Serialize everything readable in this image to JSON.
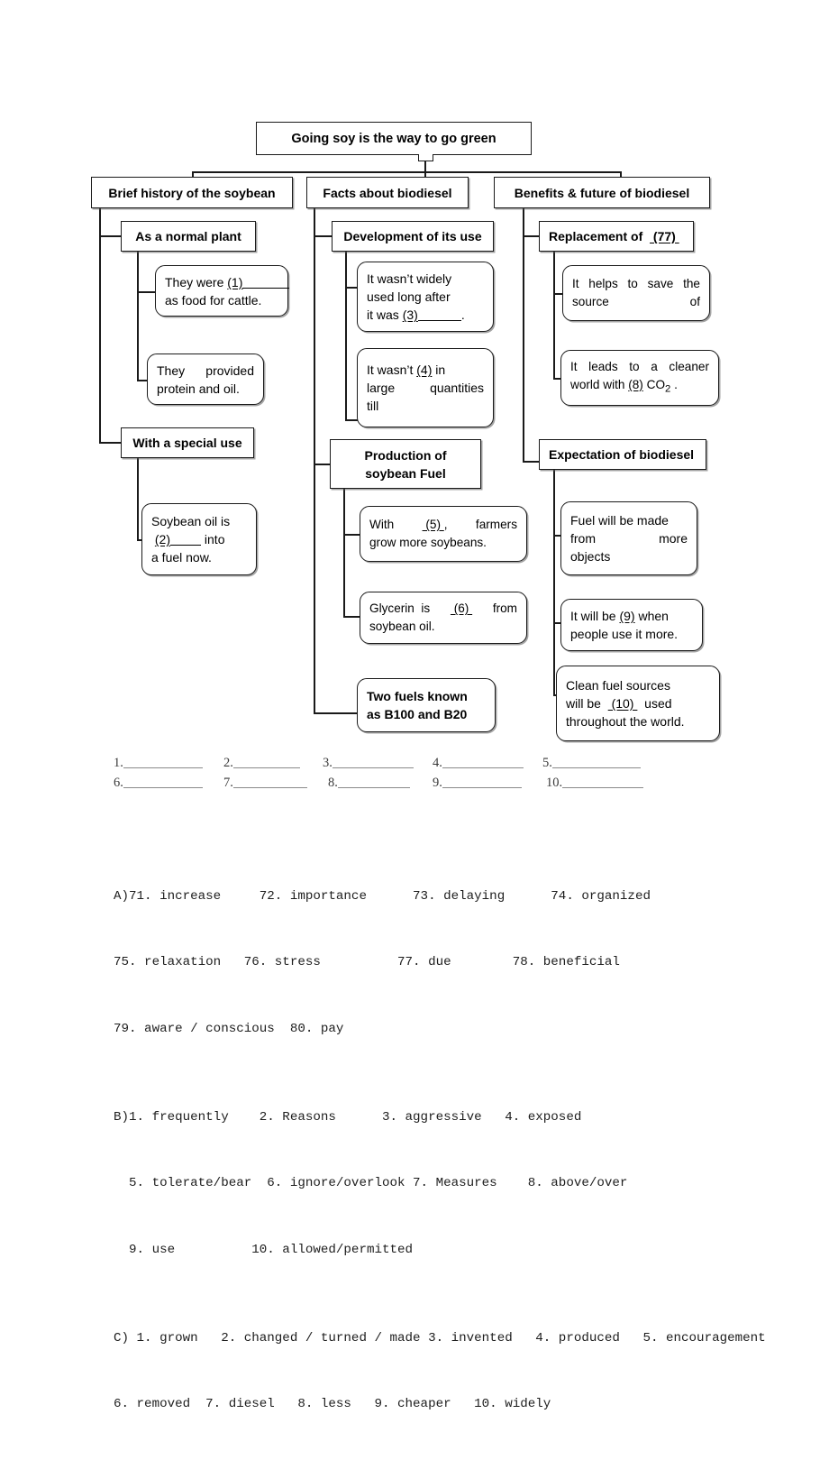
{
  "diagram": {
    "title": "Going soy is the way to go green",
    "branches": [
      {
        "heading": "Brief history of the soybean",
        "sub": [
          {
            "heading": "As a normal plant",
            "leaves": [
              {
                "lines": [
                  "They were (1)",
                  "as food for cattle."
                ],
                "blank": "(1)"
              },
              {
                "lines": [
                  "They      provided",
                  "protein and oil."
                ]
              }
            ]
          },
          {
            "heading": "With a special use",
            "leaves": [
              {
                "lines": [
                  "Soybean oil is",
                  "(2)      into",
                  "a fuel now."
                ],
                "blank": "(2)"
              }
            ]
          }
        ]
      },
      {
        "heading": "Facts about biodiesel",
        "sub": [
          {
            "heading": "Development of its use",
            "leaves": [
              {
                "lines": [
                  "It wasn’t widely",
                  "used long after",
                  "it was (3)            ."
                ],
                "blank": "(3)"
              },
              {
                "lines": [
                  "It wasn’t (4) in",
                  "large    quantities",
                  "till"
                ],
                "blank": "(4)"
              }
            ]
          },
          {
            "heading": "Production of\nsoybean Fuel",
            "heading_lines": [
              "Production of",
              "soybean Fuel"
            ],
            "leaves": [
              {
                "lines": [
                  "With    (5) ,      farmers",
                  "grow more soybeans."
                ],
                "blank": "(5)"
              },
              {
                "lines": [
                  "Glycerin  is    (6)    from",
                  "soybean oil."
                ],
                "blank": "(6)"
              }
            ]
          },
          {
            "heading": null,
            "leaves": [
              {
                "lines": [
                  "Two  fuels  known",
                  "as B100 and B20"
                ],
                "bold": true
              }
            ]
          }
        ]
      },
      {
        "heading": "Benefits & future of biodiesel",
        "sub": [
          {
            "heading": "Replacement of  (77)",
            "heading_blank": "(77)",
            "leaves": [
              {
                "lines": [
                  "It  helps  to  save  the",
                  "source                     of"
                ]
              },
              {
                "lines": [
                  "It  leads  to  a  cleaner",
                  "world with (8) CO₂ ."
                ],
                "blank": "(8)"
              }
            ]
          },
          {
            "heading": "Expectation of biodiesel",
            "leaves": [
              {
                "lines": [
                  "Fuel will be made",
                  "from              more",
                  "objects"
                ]
              },
              {
                "lines": [
                  "It will be (9) when",
                  "people use it more."
                ],
                "blank": "(9)"
              },
              {
                "lines": [
                  "Clean fuel sources",
                  "will be   (10)   used",
                  "throughout the world."
                ],
                "blank": "(10)"
              }
            ]
          }
        ]
      }
    ]
  },
  "answer_lines": {
    "row1": [
      "1.",
      "2.",
      "3.",
      "4.",
      "5."
    ],
    "row2": [
      "6.",
      "7.",
      "8.",
      "9.",
      "10."
    ]
  },
  "answer_key": {
    "sections": [
      {
        "label": "A)",
        "lines": [
          "71. increase     72. importance      73. delaying      74. organized",
          "75. relaxation   76. stress          77. due        78. beneficial",
          "79. aware / conscious  80. pay"
        ]
      },
      {
        "label": "B)",
        "lines": [
          "1. frequently    2. Reasons      3. aggressive   4. exposed",
          "  5. tolerate/bear  6. ignore/overlook 7. Measures    8. above/over",
          "  9. use          10. allowed/permitted"
        ]
      },
      {
        "label": "C)",
        "lines": [
          " 1. grown   2. changed / turned / made 3. invented   4. produced   5. encouragement",
          "6. removed  7. diesel   8. less   9. cheaper   10. widely"
        ]
      }
    ]
  }
}
